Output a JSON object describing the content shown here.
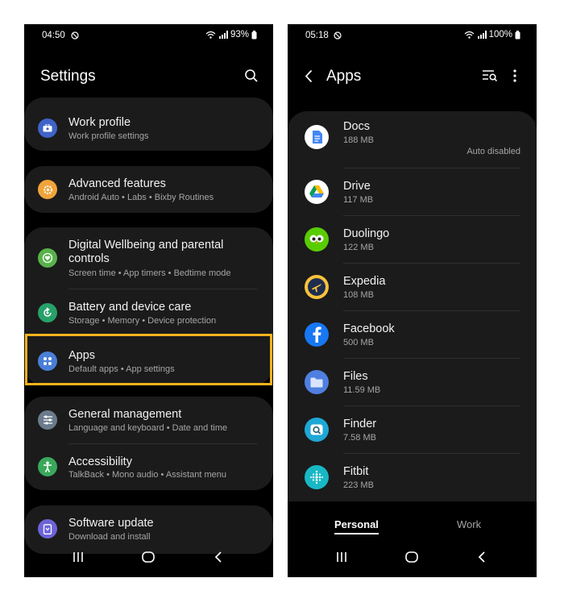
{
  "left_phone": {
    "status": {
      "time": "04:50",
      "battery": "93%"
    },
    "title": "Settings",
    "items": [
      {
        "title": "Work profile",
        "subtitle": "Work profile settings",
        "icon": "briefcase-icon",
        "color": "#3f63c8"
      },
      {
        "title": "Advanced features",
        "subtitle": "Android Auto  •  Labs  •  Bixby Routines",
        "icon": "gear-plus-icon",
        "color": "#f0a43a"
      },
      {
        "title": "Digital Wellbeing and parental controls",
        "subtitle": "Screen time  •  App timers  •  Bedtime mode",
        "icon": "heart-icon",
        "color": "#58b24a"
      },
      {
        "title": "Battery and device care",
        "subtitle": "Storage  •  Memory  •  Device protection",
        "icon": "refresh-icon",
        "color": "#28a06a"
      },
      {
        "title": "Apps",
        "subtitle": "Default apps  •  App settings",
        "icon": "apps-grid-icon",
        "color": "#4a7fd8"
      },
      {
        "title": "General management",
        "subtitle": "Language and keyboard  •  Date and time",
        "icon": "sliders-icon",
        "color": "#6b7b8c"
      },
      {
        "title": "Accessibility",
        "subtitle": "TalkBack  •  Mono audio  •  Assistant menu",
        "icon": "person-icon",
        "color": "#3aa85a"
      },
      {
        "title": "Software update",
        "subtitle": "Download and install",
        "icon": "update-icon",
        "color": "#6d63d8"
      }
    ]
  },
  "right_phone": {
    "status": {
      "time": "05:18",
      "battery": "100%"
    },
    "title": "Apps",
    "apps": [
      {
        "name": "Docs",
        "size": "188 MB",
        "note": "Auto disabled",
        "icon": "docs-icon",
        "color": "#ffffff"
      },
      {
        "name": "Drive",
        "size": "117 MB",
        "icon": "drive-icon",
        "color": "#ffffff"
      },
      {
        "name": "Duolingo",
        "size": "122 MB",
        "icon": "owl-icon",
        "color": "#58cc02"
      },
      {
        "name": "Expedia",
        "size": "108 MB",
        "icon": "plane-icon",
        "color": "#f6c23c"
      },
      {
        "name": "Facebook",
        "size": "500 MB",
        "icon": "facebook-icon",
        "color": "#1877f2"
      },
      {
        "name": "Files",
        "size": "11.59 MB",
        "icon": "folder-icon",
        "color": "#4f7fe0"
      },
      {
        "name": "Finder",
        "size": "7.58 MB",
        "icon": "finder-icon",
        "color": "#1fa7d6"
      },
      {
        "name": "Fitbit",
        "size": "223 MB",
        "icon": "fitbit-icon",
        "color": "#17b8c4"
      }
    ],
    "tabs": [
      {
        "label": "Personal"
      },
      {
        "label": "Work"
      }
    ]
  },
  "colors": {
    "highlight": "#f6b21b",
    "background": "#000000",
    "card": "#1b1b1b"
  }
}
